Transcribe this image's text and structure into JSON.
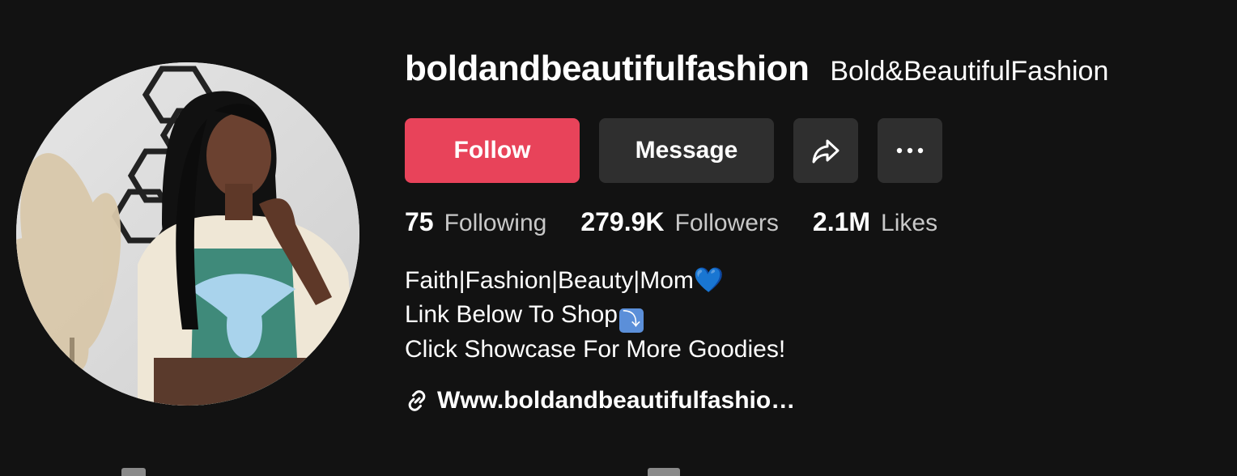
{
  "profile": {
    "username": "boldandbeautifulfashion",
    "display_name": "Bold&BeautifulFashion"
  },
  "actions": {
    "follow_label": "Follow",
    "message_label": "Message",
    "share_icon": "share-arrow-icon",
    "more_icon": "more-dots-icon"
  },
  "stats": [
    {
      "value": "75",
      "label": "Following"
    },
    {
      "value": "279.9K",
      "label": "Followers"
    },
    {
      "value": "2.1M",
      "label": "Likes"
    }
  ],
  "bio": {
    "line1": "Faith|Fashion|Beauty|Mom",
    "line1_emoji": "💙",
    "line2": "Link Below To Shop",
    "line2_emoji": "⤵",
    "line3": "Click Showcase For More Goodies!"
  },
  "link": {
    "text": "Www.boldandbeautifulfashio…",
    "icon": "link-icon"
  },
  "colors": {
    "background": "#121212",
    "follow_button": "#e8435a",
    "secondary_button": "#2f2f2f",
    "muted_text": "#c8c8c8"
  }
}
